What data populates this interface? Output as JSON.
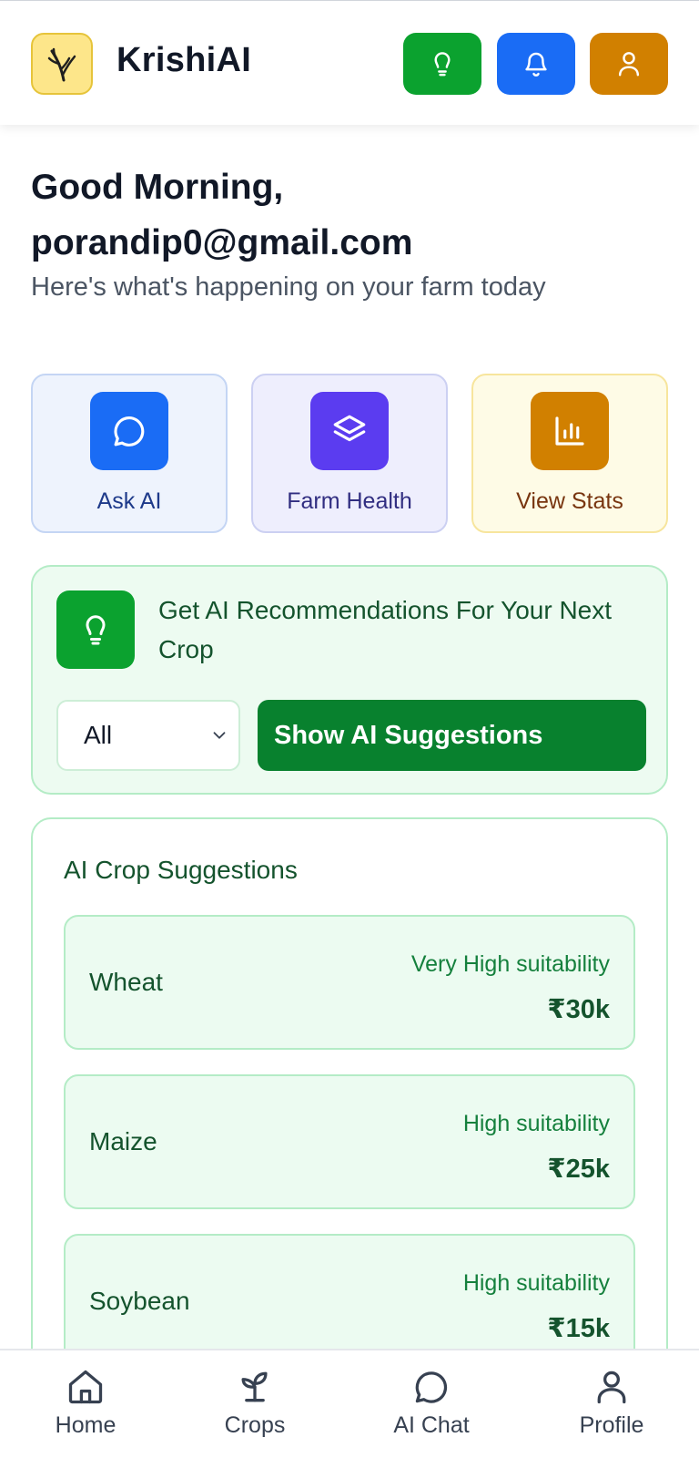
{
  "header": {
    "app_title": "KrishiAI",
    "buttons": [
      {
        "name": "lightbulb-icon",
        "color": "#0ba22f"
      },
      {
        "name": "bell-icon",
        "color": "#1a6cf5"
      },
      {
        "name": "user-icon",
        "color": "#d18000"
      }
    ]
  },
  "greeting": {
    "line1": "Good Morning,",
    "line2": "porandip0@gmail.com",
    "subtitle": "Here's what's happening on your farm today"
  },
  "quick_actions": [
    {
      "label": "Ask AI",
      "icon": "chat-bubble-icon",
      "color": "#1a6cf5"
    },
    {
      "label": "Farm Health",
      "icon": "layers-icon",
      "color": "#5b3cf0"
    },
    {
      "label": "View Stats",
      "icon": "bar-chart-icon",
      "color": "#d18000"
    }
  ],
  "recommendation": {
    "title": "Get AI Recommendations For Your Next Crop",
    "select_value": "All",
    "button_label": "Show AI Suggestions"
  },
  "suggestions": {
    "title": "AI Crop Suggestions",
    "items": [
      {
        "crop": "Wheat",
        "suitability": "Very High suitability",
        "price": "₹30k"
      },
      {
        "crop": "Maize",
        "suitability": "High suitability",
        "price": "₹25k"
      },
      {
        "crop": "Soybean",
        "suitability": "High suitability",
        "price": "₹15k"
      }
    ]
  },
  "nav": {
    "items": [
      {
        "label": "Home",
        "icon": "home-icon"
      },
      {
        "label": "Crops",
        "icon": "sprout-icon"
      },
      {
        "label": "AI Chat",
        "icon": "chat-bubble-icon"
      },
      {
        "label": "Profile",
        "icon": "user-icon"
      }
    ]
  }
}
